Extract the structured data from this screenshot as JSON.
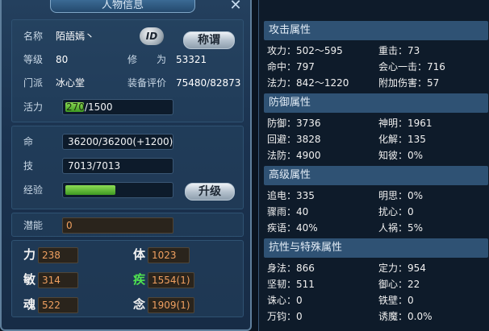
{
  "left": {
    "title": "人物信息",
    "name_label": "名称",
    "name_value": "陌語嫣丶",
    "id_label": "ID",
    "title_button": "称谓",
    "level_label": "等级",
    "level_value": "80",
    "cultivation_label": "修　　为",
    "cultivation_value": "53321",
    "sect_label": "门派",
    "sect_value": "冰心堂",
    "gear_label": "装备评价",
    "gear_value": "75480/82873",
    "vitality_label": "活力",
    "vitality_current": "270",
    "vitality_max": "/1500",
    "vitality_fraction": 0.18,
    "hp_label": "命",
    "hp_value": "36200/36200(+1200)",
    "mp_label": "技",
    "mp_value": "7013/7013",
    "exp_label": "经验",
    "exp_fraction": 0.48,
    "upgrade_button": "升级",
    "potential_label": "潜能",
    "potential_value": "0",
    "attrs": [
      {
        "label": "力",
        "value": "238"
      },
      {
        "label": "体",
        "value": "1023"
      },
      {
        "label": "敏",
        "value": "314"
      },
      {
        "label": "疾",
        "value": "1554(1)"
      },
      {
        "label": "魂",
        "value": "522"
      },
      {
        "label": "念",
        "value": "1909(1)"
      }
    ]
  },
  "right": {
    "attack": {
      "header": "攻击属性",
      "rows": [
        [
          "攻力：502～595",
          "重击：73"
        ],
        [
          "命中：797",
          "会心一击：716"
        ],
        [
          "法力：842～1220",
          "附加伤害：57"
        ]
      ]
    },
    "defense": {
      "header": "防御属性",
      "rows": [
        [
          "防御：3736",
          "神明：1961"
        ],
        [
          "回避：3828",
          "化解：135"
        ],
        [
          "法防：4900",
          "知彼：0%"
        ]
      ]
    },
    "advanced": {
      "header": "高级属性",
      "rows": [
        [
          "追电：335",
          "明思：0%"
        ],
        [
          "骤雨：40",
          "扰心：0"
        ],
        [
          "疾语：40%",
          "人祸：5%"
        ]
      ]
    },
    "resist": {
      "header": "抗性与特殊属性",
      "rows": [
        [
          "身法：866",
          "定力：954"
        ],
        [
          "坚韧：511",
          "御心：22"
        ],
        [
          "诛心：0",
          "铁壁：0"
        ],
        [
          "万钧：0",
          "诱魔：0.0%"
        ]
      ]
    }
  }
}
